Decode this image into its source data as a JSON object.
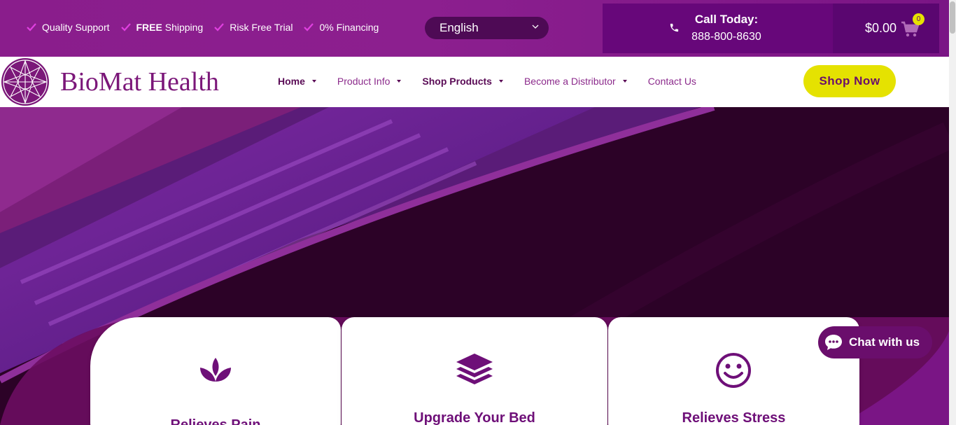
{
  "topbar": {
    "perks": [
      {
        "icon": "check-icon",
        "bold": "",
        "text": "Quality Support"
      },
      {
        "icon": "check-icon",
        "bold": "FREE",
        "text": " Shipping"
      },
      {
        "icon": "check-icon",
        "bold": "",
        "text": "Risk Free Trial"
      },
      {
        "icon": "check-icon",
        "bold": "",
        "text": "0% Financing"
      }
    ],
    "language": "English",
    "call_title": "Call Today:",
    "call_phone": "888-800-8630",
    "cart_total": "$0.00",
    "cart_count": "0"
  },
  "header": {
    "logo_text": "BioMat Health",
    "nav": [
      {
        "label": "Home"
      },
      {
        "label": "Product Info"
      },
      {
        "label": "Shop Products"
      },
      {
        "label": "Become a Distributor"
      },
      {
        "label": "Contact Us"
      }
    ],
    "shop_now": "Shop Now"
  },
  "cards": [
    {
      "title": "Relieves Pain",
      "icon": "lotus-icon"
    },
    {
      "title": "Upgrade Your Bed",
      "icon": "layers-icon"
    },
    {
      "title": "Relieves Stress",
      "icon": "smile-icon"
    }
  ],
  "chat": {
    "label": "Chat with us"
  },
  "colors": {
    "brand_purple": "#6e0f78",
    "accent_yellow": "#e5e201",
    "topbar_purple": "#8a1d8c"
  }
}
